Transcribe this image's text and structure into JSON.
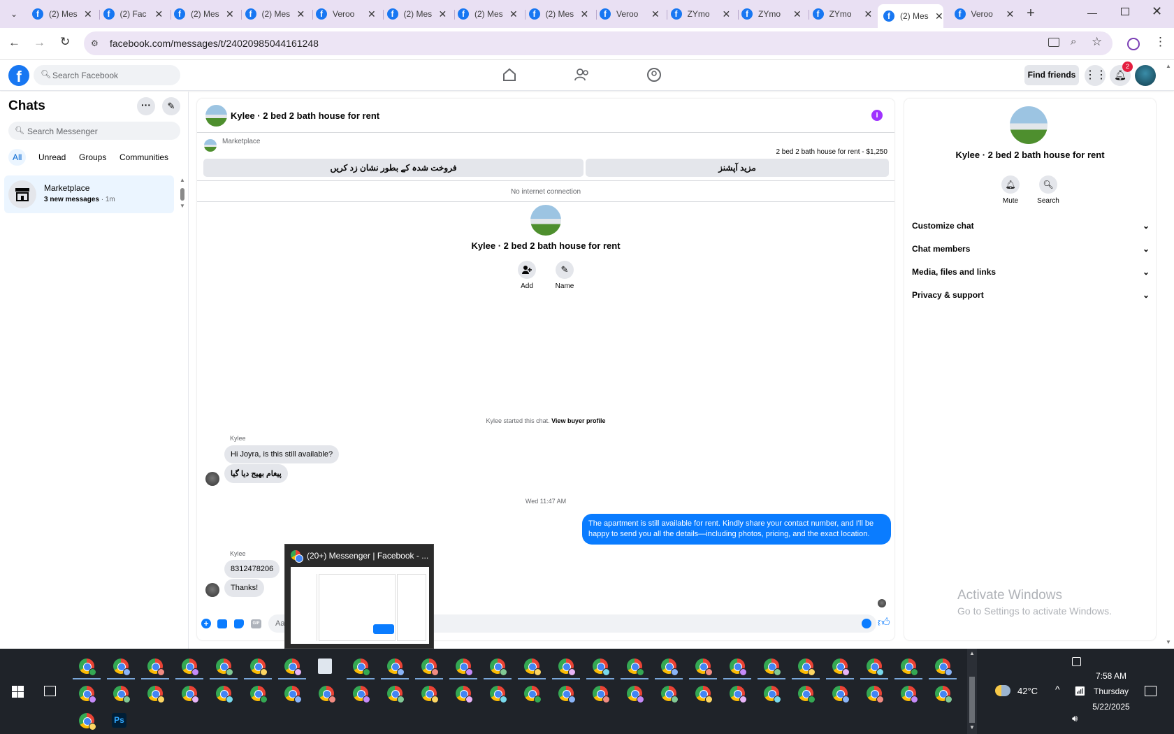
{
  "browser": {
    "tabs": [
      {
        "title": "(2) Mes"
      },
      {
        "title": "(2) Fac"
      },
      {
        "title": "(2) Mes"
      },
      {
        "title": "(2) Mes"
      },
      {
        "title": "Veroo"
      },
      {
        "title": "(2) Mes"
      },
      {
        "title": "(2) Mes"
      },
      {
        "title": "(2) Mes"
      },
      {
        "title": "Veroo"
      },
      {
        "title": "ZYmo"
      },
      {
        "title": "ZYmo"
      },
      {
        "title": "ZYmo"
      },
      {
        "title": "(2) Mes"
      },
      {
        "title": "Veroo"
      }
    ],
    "url": "facebook.com/messages/t/24020985044161248"
  },
  "fb": {
    "search_placeholder": "Search Facebook",
    "find_friends": "Find friends",
    "notif_count": "2"
  },
  "chats": {
    "title": "Chats",
    "search_placeholder": "Search Messenger",
    "filters": [
      "All",
      "Unread",
      "Groups",
      "Communities"
    ],
    "item": {
      "name": "Marketplace",
      "subtitle_bold": "3 new messages",
      "subtitle_time": " · 1m"
    }
  },
  "conversation": {
    "title": "Kylee · 2 bed 2 bath house for rent",
    "marketplace_label": "Marketplace",
    "listing": "2 bed 2 bath house for rent - $1,250",
    "btn_mark_sold": "فروخت شدہ کے بطور نشان زد کریں",
    "btn_more_options": "مزید آپشنز",
    "no_internet": "No internet connection",
    "profile_name": "Kylee · 2 bed 2 bath house for rent",
    "add_label": "Add",
    "name_label": "Name",
    "started_text": "Kylee started this chat.",
    "view_buyer": "View buyer profile",
    "sender1": "Kylee",
    "msg1": "Hi Joyra, is this still available?",
    "msg2": "پیغام بھیج دیا گیا",
    "timestamp": "Wed 11:47 AM",
    "out_line1": "The apartment is still available for rent. Kindly share your contact number, and I'll be",
    "out_line2": "happy to send you all the details—including photos, pricing, and the exact location.",
    "sender2": "Kylee",
    "msg3": "8312478206",
    "msg4": "Thanks!",
    "composer_placeholder": "Aa"
  },
  "tooltip": {
    "title": "(20+) Messenger | Facebook - ..."
  },
  "details": {
    "name": "Kylee · 2 bed 2 bath house for rent",
    "mute": "Mute",
    "search": "Search",
    "sections": [
      "Customize chat",
      "Chat members",
      "Media, files and links",
      "Privacy & support"
    ]
  },
  "watermark": {
    "line1": "Activate Windows",
    "line2": "Go to Settings to activate Windows."
  },
  "taskbar": {
    "weather": "42°C",
    "time": "7:58 AM",
    "day": "Thursday",
    "date": "5/22/2025",
    "ps_label": "Ps"
  },
  "colors": {
    "fb_blue": "#1877f2",
    "bubble_out": "#0a7cff",
    "tabstrip": "#e9e0f3",
    "taskbar": "#1f2329"
  }
}
